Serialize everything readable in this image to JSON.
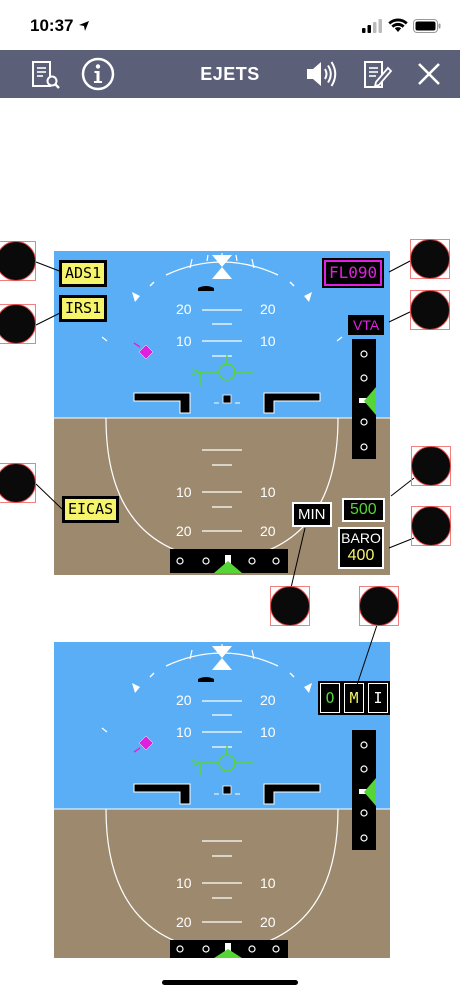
{
  "status_bar": {
    "time": "10:37",
    "location_icon": "location-arrow-icon",
    "signal_icon": "cellular-signal-icon",
    "wifi_icon": "wifi-icon",
    "battery_icon": "battery-icon"
  },
  "nav": {
    "title": "EJETS",
    "left_icons": [
      "document-search-icon",
      "info-icon"
    ],
    "right_icons": [
      "speaker-icon",
      "notes-edit-icon",
      "close-icon"
    ],
    "bar_color": "#5c5f78"
  },
  "pfd_top": {
    "labels": {
      "ads": "ADS1",
      "irs": "IRS1",
      "eicas": "EICAS",
      "fl": "FL090",
      "vta": "VTA",
      "min": "MIN",
      "radio_alt": "500",
      "baro_label": "BARO",
      "baro_value": "400"
    },
    "pitch_labels": [
      "20",
      "20",
      "10",
      "10",
      "10",
      "10",
      "20",
      "20"
    ]
  },
  "pfd_bottom": {
    "mode_letters": [
      "O",
      "M",
      "I"
    ],
    "pitch_labels": [
      "20",
      "20",
      "10",
      "10",
      "10",
      "10",
      "20",
      "20"
    ]
  },
  "colors": {
    "sky": "#5aaef5",
    "ground": "#9d8a6e",
    "yellow_tag": "#f6f46a",
    "magenta": "#e020e0",
    "green": "#56d636",
    "callout_red": "#e04848"
  }
}
